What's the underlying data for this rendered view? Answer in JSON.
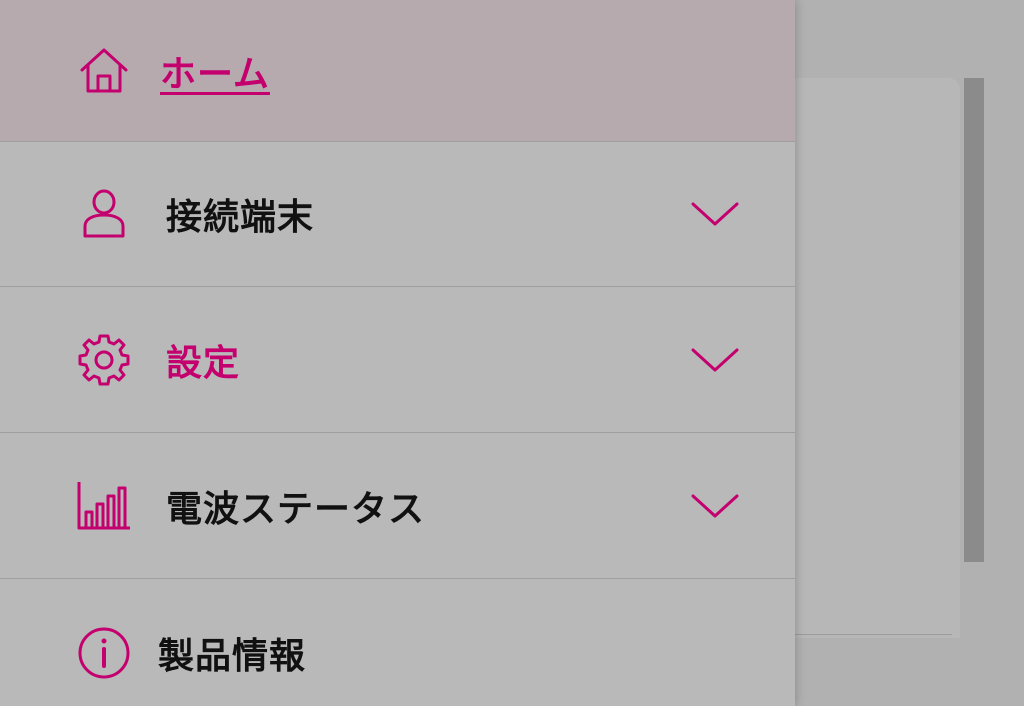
{
  "colors": {
    "accent": "#c4006e",
    "overlay": "#b1b1b1",
    "drawer_bg": "#b9b9b9",
    "active_bg": "#b6aaaf",
    "text": "#111111"
  },
  "menu": {
    "items": [
      {
        "label": "ホーム",
        "icon": "home-icon",
        "active": true
      },
      {
        "label": "接続端末",
        "icon": "user-icon",
        "expandable": true
      },
      {
        "label": "設定",
        "icon": "gear-icon",
        "expandable": true
      },
      {
        "label": "電波ステータス",
        "icon": "signal-bars-icon",
        "expandable": true
      },
      {
        "label": "製品情報",
        "icon": "info-icon"
      }
    ]
  }
}
